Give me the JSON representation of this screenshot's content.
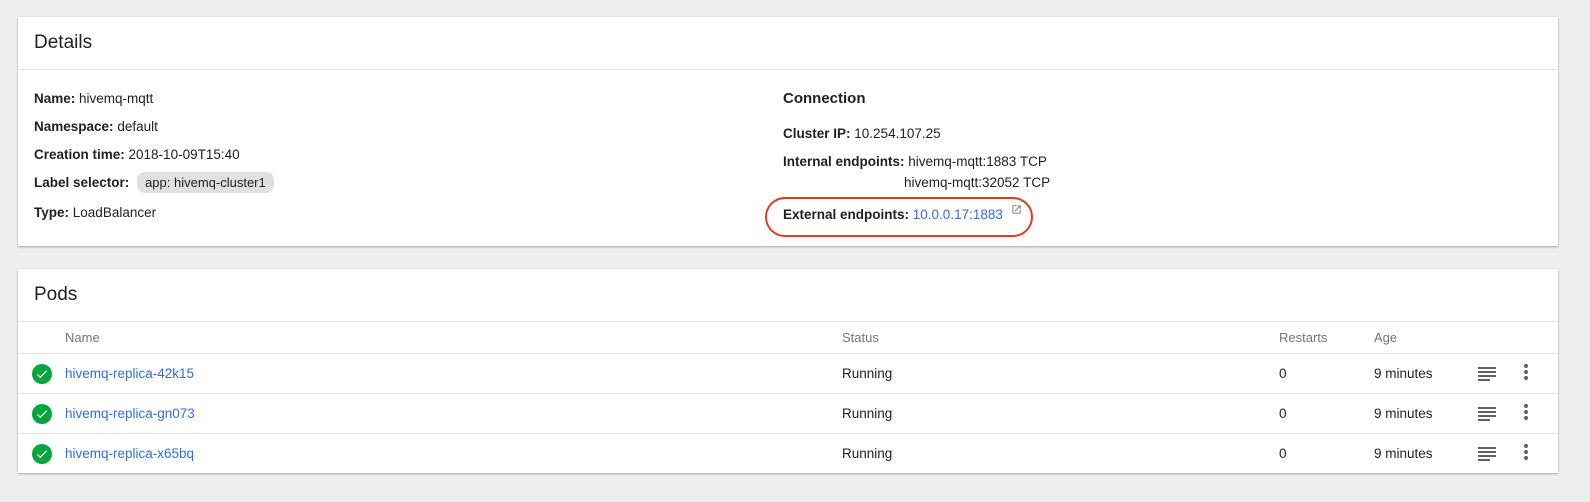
{
  "details": {
    "title": "Details",
    "name_label": "Name:",
    "name_value": "hivemq-mqtt",
    "namespace_label": "Namespace:",
    "namespace_value": "default",
    "creation_label": "Creation time:",
    "creation_value": "2018-10-09T15:40",
    "label_selector_label": "Label selector:",
    "label_selector_value": "app: hivemq-cluster1",
    "type_label": "Type:",
    "type_value": "LoadBalancer"
  },
  "connection": {
    "title": "Connection",
    "cluster_ip_label": "Cluster IP:",
    "cluster_ip_value": "10.254.107.25",
    "internal_label": "Internal endpoints:",
    "internal_endpoints": [
      "hivemq-mqtt:1883 TCP",
      "hivemq-mqtt:32052 TCP"
    ],
    "external_label": "External endpoints:",
    "external_value": "10.0.0.17:1883"
  },
  "pods": {
    "title": "Pods",
    "columns": {
      "name": "Name",
      "status": "Status",
      "restarts": "Restarts",
      "age": "Age"
    },
    "rows": [
      {
        "name": "hivemq-replica-42k15",
        "status": "Running",
        "restarts": "0",
        "age": "9 minutes"
      },
      {
        "name": "hivemq-replica-gn073",
        "status": "Running",
        "restarts": "0",
        "age": "9 minutes"
      },
      {
        "name": "hivemq-replica-x65bq",
        "status": "Running",
        "restarts": "0",
        "age": "9 minutes"
      }
    ]
  },
  "icons": {
    "status": "check-circle-icon",
    "external_link": "open-in-new-icon",
    "logs": "logs-icon",
    "more": "more-vert-icon"
  },
  "colors": {
    "link": "#326de6",
    "success": "#00a53c",
    "highlight": "#e8391f"
  }
}
